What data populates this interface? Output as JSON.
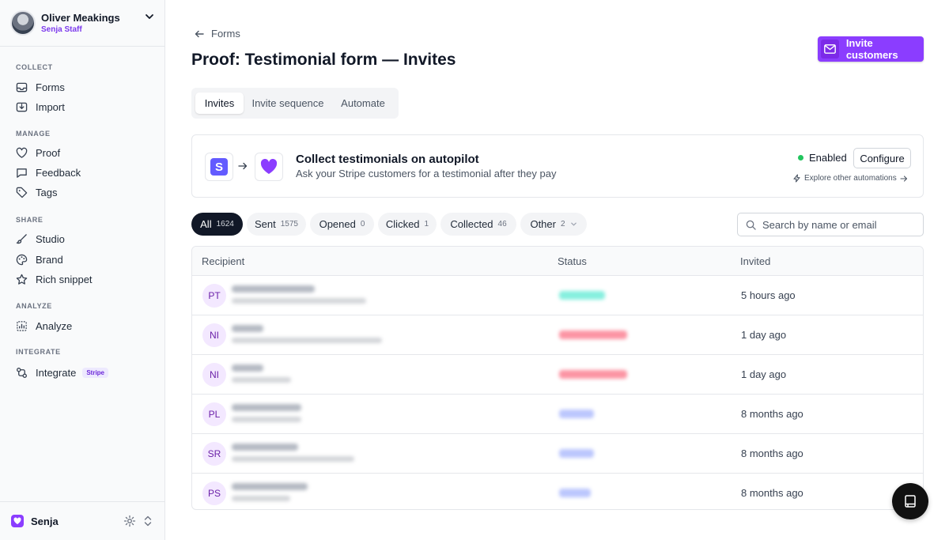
{
  "profile": {
    "name": "Oliver Meakings",
    "role": "Senja Staff"
  },
  "sidebar": {
    "sections": {
      "collect": "COLLECT",
      "manage": "MANAGE",
      "share": "SHARE",
      "analyze": "ANALYZE",
      "integrate": "INTEGRATE"
    },
    "items": {
      "forms": "Forms",
      "import": "Import",
      "proof": "Proof",
      "feedback": "Feedback",
      "tags": "Tags",
      "studio": "Studio",
      "brand": "Brand",
      "rich_snippet": "Rich snippet",
      "analyze": "Analyze",
      "integrate": "Integrate",
      "integrate_badge": "Stripe"
    },
    "footer": {
      "brand": "Senja"
    }
  },
  "header": {
    "back_label": "Forms",
    "title": "Proof: Testimonial form — Invites",
    "invite_button": "Invite customers",
    "accent": "#8b3dff"
  },
  "tabs": [
    {
      "label": "Invites",
      "active": true
    },
    {
      "label": "Invite sequence",
      "active": false
    },
    {
      "label": "Automate",
      "active": false
    }
  ],
  "automation": {
    "stripe_letter": "S",
    "title": "Collect testimonials on autopilot",
    "subtitle": "Ask your Stripe customers for a testimonial after they pay",
    "status": "Enabled",
    "configure": "Configure",
    "explore": "Explore other automations"
  },
  "filters": [
    {
      "label": "All",
      "count": "1624",
      "active": true
    },
    {
      "label": "Sent",
      "count": "1575",
      "active": false
    },
    {
      "label": "Opened",
      "count": "0",
      "active": false
    },
    {
      "label": "Clicked",
      "count": "1",
      "active": false
    },
    {
      "label": "Collected",
      "count": "46",
      "active": false
    },
    {
      "label": "Other",
      "count": "2",
      "active": false
    }
  ],
  "search": {
    "placeholder": "Search by name or email",
    "value": ""
  },
  "table": {
    "columns": {
      "recipient": "Recipient",
      "status": "Status",
      "invited": "Invited"
    },
    "rows": [
      {
        "initials": "PT",
        "invited": "5 hours ago",
        "status_color": "#5eead4"
      },
      {
        "initials": "NI",
        "invited": "1 day ago",
        "status_color": "#fb7185"
      },
      {
        "initials": "NI",
        "invited": "1 day ago",
        "status_color": "#fb7185"
      },
      {
        "initials": "PL",
        "invited": "8 months ago",
        "status_color": "#a5b4fc"
      },
      {
        "initials": "SR",
        "invited": "8 months ago",
        "status_color": "#a5b4fc"
      },
      {
        "initials": "PS",
        "invited": "8 months ago",
        "status_color": "#a5b4fc"
      }
    ]
  }
}
